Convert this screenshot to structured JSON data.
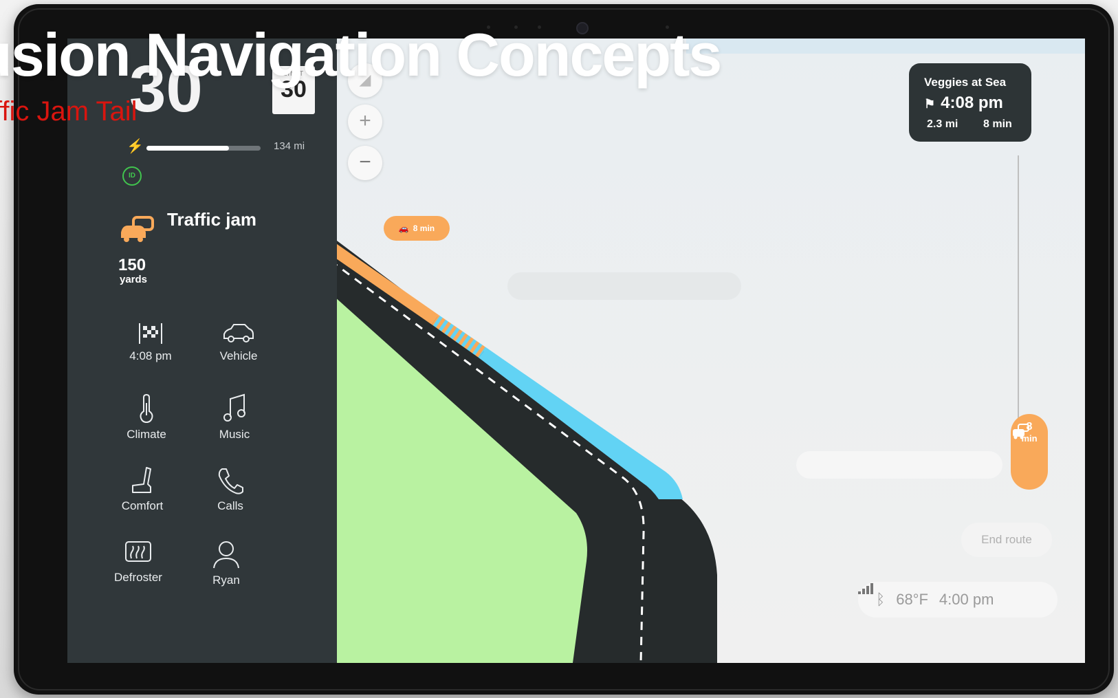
{
  "overlay": {
    "title": "usion Navigation Concepts",
    "subtitle": "ffic Jam Tail"
  },
  "cluster": {
    "speed": "30",
    "speed_limit_label": "LIMIT",
    "speed_limit": "30",
    "charge_level": 0.72,
    "range": "134 mi"
  },
  "alert": {
    "title": "Traffic jam",
    "distance": "150",
    "distance_unit": "yards"
  },
  "tiles": [
    {
      "label": "4:08 pm",
      "icon": "checkered-flag-icon"
    },
    {
      "label": "Vehicle",
      "icon": "car-icon"
    },
    {
      "label": "Climate",
      "icon": "thermometer-icon"
    },
    {
      "label": "Music",
      "icon": "music-note-icon"
    },
    {
      "label": "Comfort",
      "icon": "seat-icon"
    },
    {
      "label": "Calls",
      "icon": "phone-icon"
    },
    {
      "label": "Defroster",
      "icon": "defroster-icon"
    },
    {
      "label": "Ryan",
      "icon": "user-icon"
    }
  ],
  "map": {
    "zoom_in": "+",
    "zoom_out": "−",
    "traffic_pill": "8 min",
    "delay_value": "8",
    "delay_unit": "min",
    "end_route": "End route"
  },
  "destination": {
    "name": "Veggies at Sea",
    "eta": "4:08 pm",
    "distance": "2.3 mi",
    "duration": "8 min"
  },
  "status_bar": {
    "temperature": "68°F",
    "time": "4:00 pm"
  },
  "colors": {
    "panel": "#30373a",
    "traffic_orange": "#f9a95a",
    "route_blue": "#62d3f4",
    "park_green": "#b9f2a1",
    "eco_green": "#41c44e",
    "subtitle_red": "#d9150f"
  }
}
